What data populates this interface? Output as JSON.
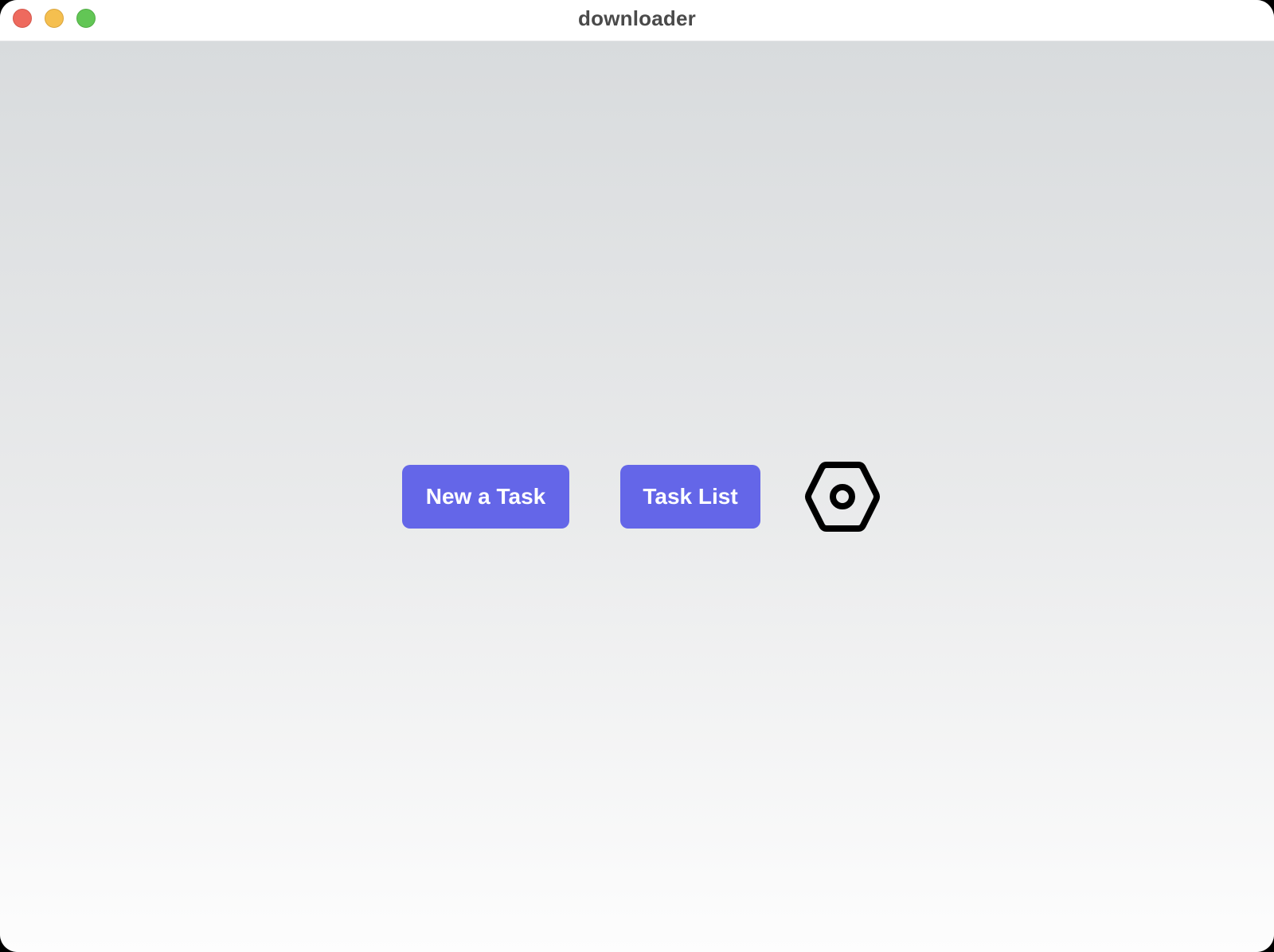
{
  "window": {
    "title": "downloader",
    "controls": [
      "close",
      "minimize",
      "zoom"
    ]
  },
  "main": {
    "new_task_label": "New a Task",
    "task_list_label": "Task List",
    "settings_icon": "settings-gear-icon"
  },
  "colors": {
    "button_bg": "#6466e8",
    "button_text": "#ffffff",
    "close": "#ee6a5e",
    "minimize": "#f5bf4f",
    "zoom": "#62c655",
    "gradient_top": "#d8dbdd",
    "gradient_bottom": "#fdfdfd"
  }
}
